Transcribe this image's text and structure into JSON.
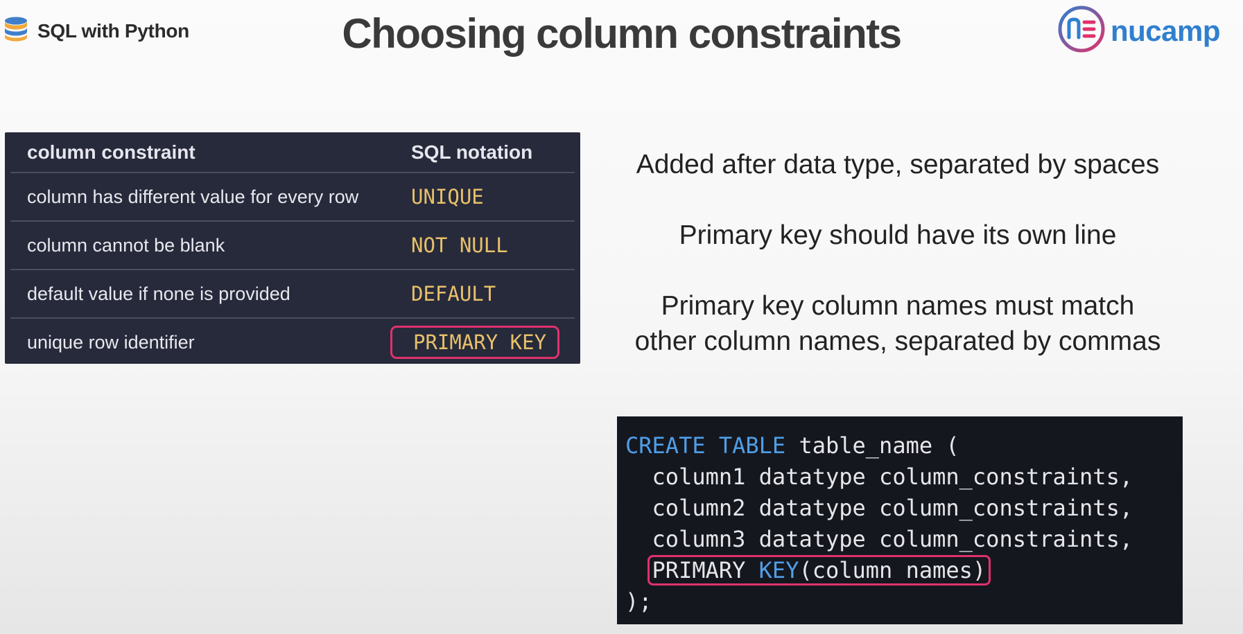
{
  "header": {
    "brand_title": "SQL with Python",
    "page_title": "Choosing column constraints",
    "logo_text": "nucamp"
  },
  "constraints_table": {
    "headers": [
      "column constraint",
      "SQL notation"
    ],
    "rows": [
      {
        "description": "column has different value for every row",
        "notation": "UNIQUE"
      },
      {
        "description": "column cannot be blank",
        "notation": "NOT NULL"
      },
      {
        "description": "default value if none is provided",
        "notation": "DEFAULT"
      },
      {
        "description": "unique row identifier",
        "notation": "PRIMARY KEY"
      }
    ]
  },
  "notes": [
    "Added after data type, separated by spaces",
    "Primary key should have its own line",
    "Primary key column names must match",
    "other column names, separated by commas"
  ],
  "code": {
    "kw_create": "CREATE",
    "kw_table": "TABLE",
    "table_rest": " table_name (",
    "line1": "  column1 datatype column_constraints,",
    "line2": "  column2 datatype column_constraints,",
    "line3": "  column3 datatype column_constraints,",
    "kw_primary": "PRIMARY",
    "kw_key": "KEY",
    "pk_rest": "(column names)",
    "closing": ");"
  },
  "colors": {
    "table_bg": "#272a3b",
    "notation": "#e7c06a",
    "highlight_border": "#e0316d",
    "code_bg": "#15171f",
    "keyword": "#4f9fe8",
    "logo": "#2f7fcf"
  },
  "icons": [
    "database-icon",
    "nucamp-logo-icon"
  ]
}
